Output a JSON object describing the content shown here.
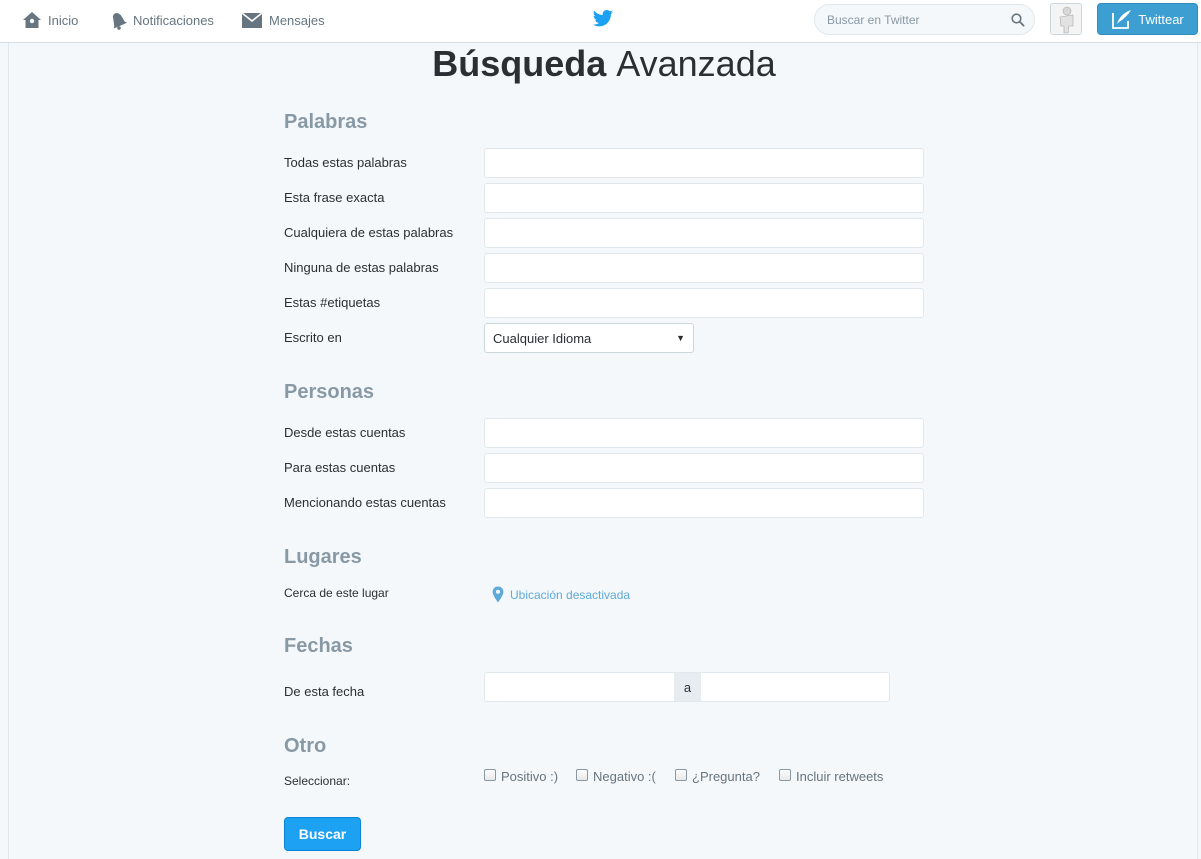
{
  "nav": {
    "home_label": "Inicio",
    "notifications_label": "Notificaciones",
    "messages_label": "Mensajes",
    "search_placeholder": "Buscar en Twitter",
    "tweet_label": "Twittear"
  },
  "page": {
    "title_bold": "Búsqueda",
    "title_light": "Avanzada"
  },
  "sections": {
    "words": {
      "title": "Palabras",
      "all_words": "Todas estas palabras",
      "exact_phrase": "Esta frase exacta",
      "any_words": "Cualquiera de estas palabras",
      "none_words": "Ninguna de estas palabras",
      "hashtags": "Estas #etiquetas",
      "language_label": "Escrito en",
      "language_value": "Cualquier Idioma"
    },
    "people": {
      "title": "Personas",
      "from_accounts": "Desde estas cuentas",
      "to_accounts": "Para estas cuentas",
      "mentioning_accounts": "Mencionando estas cuentas"
    },
    "places": {
      "title": "Lugares",
      "near_label": "Cerca de este lugar",
      "location_status": "Ubicación desactivada"
    },
    "dates": {
      "title": "Fechas",
      "from_date_label": "De esta fecha",
      "separator": "a"
    },
    "other": {
      "title": "Otro",
      "select_label": "Seleccionar:",
      "options": [
        "Positivo :)",
        "Negativo :(",
        "¿Pregunta?",
        "Incluir retweets"
      ]
    }
  },
  "submit_label": "Buscar",
  "colors": {
    "brand_blue": "#1da1f2",
    "tweet_button": "#3d9fd1",
    "section_title": "#8899a6",
    "link": "#5eaad9"
  }
}
